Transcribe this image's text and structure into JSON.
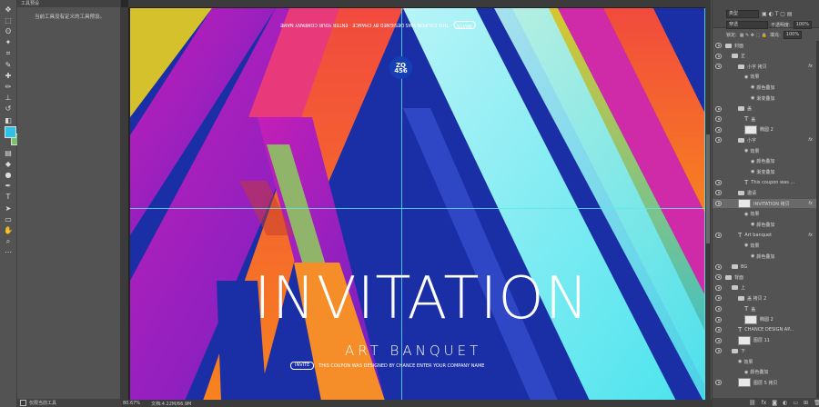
{
  "toolbar": {
    "tools": [
      "move-icon",
      "marquee-icon",
      "lasso-icon",
      "magic-wand-icon",
      "crop-icon",
      "eyedropper-icon",
      "healing-brush-icon",
      "brush-icon",
      "clone-stamp-icon",
      "history-brush-icon",
      "eraser-icon",
      "gradient-icon",
      "blur-icon",
      "dodge-icon",
      "pen-icon",
      "type-icon",
      "path-select-icon",
      "shape-icon",
      "hand-icon",
      "zoom-icon",
      "more-icon"
    ],
    "foreground_color": "#2ec3e6",
    "background_color": "#7bc36a"
  },
  "options_panel": {
    "tab_label": "工具预设",
    "message": "当前工具没有定义的工具预设。",
    "footer_checkbox_label": "仅限当前工具"
  },
  "canvas": {
    "flipped_badge": "INVITE",
    "flipped_text": "THIS COUPON WAS DESIGNED BY CHANCE · ENTER YOUR COMPANY NAME",
    "logo_text": "ZQ\n456",
    "title": "INVITATION",
    "subtitle": "ART BANQUET",
    "badge": "INVITE",
    "line_text": "THIS COUPON WAS DESIGNED BY CHANCE    ENTER YOUR COMPANY NAME"
  },
  "status": {
    "zoom": "80.67%",
    "doc": "文档:4.22M/66.9M"
  },
  "layers_panel": {
    "kind_label": "类型",
    "blend_mode": "穿透",
    "opacity_label": "不透明度:",
    "opacity_value": "100%",
    "lock_label": "锁定:",
    "fill_label": "填充:",
    "fill_value": "100%",
    "layers": [
      {
        "name": "封面",
        "type": "folder",
        "indent": 0,
        "fx": false
      },
      {
        "name": "正",
        "type": "folder",
        "indent": 1,
        "fx": false
      },
      {
        "name": "小字 拷贝",
        "type": "folder",
        "indent": 2,
        "fx": true
      },
      {
        "name": "效果",
        "type": "effect",
        "indent": 3,
        "fx": false
      },
      {
        "name": "颜色叠加",
        "type": "effect",
        "indent": 4,
        "fx": false
      },
      {
        "name": "渐变叠加",
        "type": "effect",
        "indent": 4,
        "fx": false
      },
      {
        "name": "盖",
        "type": "folder",
        "indent": 2,
        "fx": false
      },
      {
        "name": "盖",
        "type": "text",
        "indent": 3,
        "fx": false
      },
      {
        "name": "椭圆 2",
        "type": "image",
        "indent": 3,
        "fx": false
      },
      {
        "name": "小字",
        "type": "folder",
        "indent": 2,
        "fx": true
      },
      {
        "name": "效果",
        "type": "effect",
        "indent": 3,
        "fx": false
      },
      {
        "name": "颜色叠加",
        "type": "effect",
        "indent": 4,
        "fx": false
      },
      {
        "name": "渐变叠加",
        "type": "effect",
        "indent": 4,
        "fx": false
      },
      {
        "name": "This coupon was ...",
        "type": "text",
        "indent": 3,
        "fx": false
      },
      {
        "name": "邀请",
        "type": "folder",
        "indent": 2,
        "fx": false
      },
      {
        "name": "INVITATION 拷贝",
        "type": "image",
        "indent": 2,
        "fx": true
      },
      {
        "name": "效果",
        "type": "effect",
        "indent": 3,
        "fx": false
      },
      {
        "name": "颜色叠加",
        "type": "effect",
        "indent": 4,
        "fx": false
      },
      {
        "name": "Art banquet",
        "type": "text",
        "indent": 2,
        "fx": true
      },
      {
        "name": "效果",
        "type": "effect",
        "indent": 3,
        "fx": false
      },
      {
        "name": "颜色叠加",
        "type": "effect",
        "indent": 4,
        "fx": false
      },
      {
        "name": "BG",
        "type": "folder",
        "indent": 1,
        "fx": false
      },
      {
        "name": "背面",
        "type": "folder",
        "indent": 0,
        "fx": false
      },
      {
        "name": "上",
        "type": "folder",
        "indent": 1,
        "fx": false
      },
      {
        "name": "盖 拷贝 2",
        "type": "folder",
        "indent": 2,
        "fx": false
      },
      {
        "name": "盖",
        "type": "text",
        "indent": 3,
        "fx": false
      },
      {
        "name": "椭圆 2",
        "type": "image",
        "indent": 3,
        "fx": false
      },
      {
        "name": "CHANCE DESIGN AP...",
        "type": "text",
        "indent": 2,
        "fx": false
      },
      {
        "name": "图层 11",
        "type": "image",
        "indent": 2,
        "fx": false
      },
      {
        "name": "下",
        "type": "folder",
        "indent": 1,
        "fx": false
      },
      {
        "name": "效果",
        "type": "effect",
        "indent": 2,
        "fx": false
      },
      {
        "name": "颜色叠加",
        "type": "effect",
        "indent": 3,
        "fx": false
      },
      {
        "name": "图层 5 拷贝",
        "type": "image",
        "indent": 2,
        "fx": false
      }
    ]
  }
}
